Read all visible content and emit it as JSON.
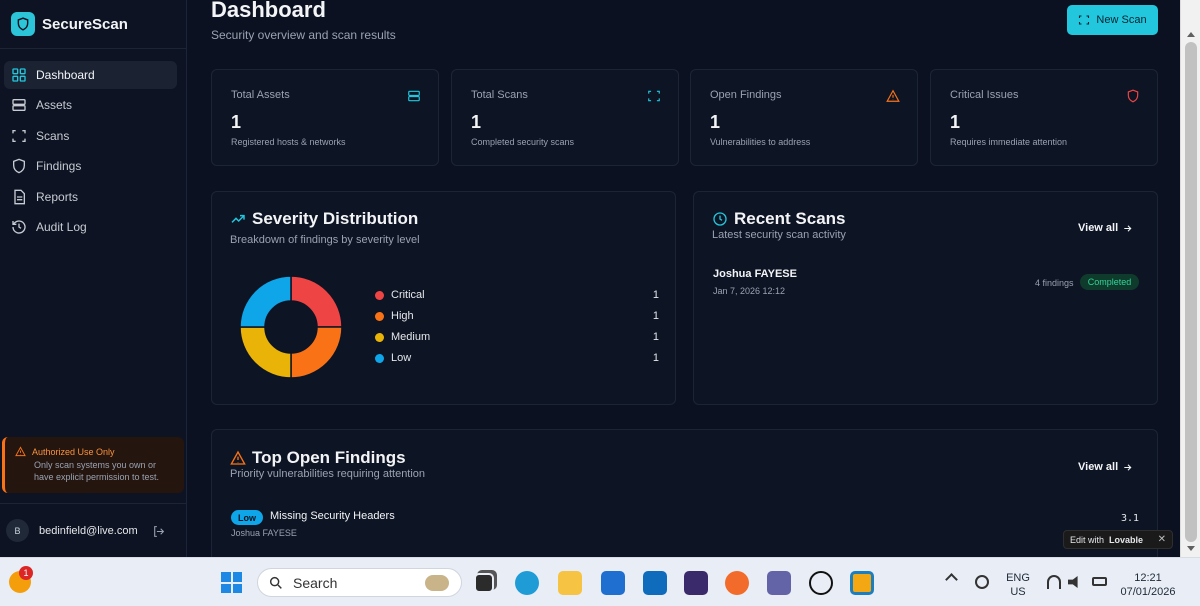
{
  "app": {
    "name": "SecureScan"
  },
  "sidebar": {
    "items": [
      {
        "label": "Dashboard",
        "icon": "dashboard-icon",
        "active": true
      },
      {
        "label": "Assets",
        "icon": "server-icon"
      },
      {
        "label": "Scans",
        "icon": "scan-icon"
      },
      {
        "label": "Findings",
        "icon": "shield-icon"
      },
      {
        "label": "Reports",
        "icon": "report-icon"
      },
      {
        "label": "Audit Log",
        "icon": "history-icon"
      }
    ],
    "warning": {
      "title": "Authorized Use Only",
      "text": "Only scan systems you own or have explicit permission to test."
    },
    "user": {
      "initial": "B",
      "email": "bedinfield@live.com"
    }
  },
  "header": {
    "title": "Dashboard",
    "subtitle": "Security overview and scan results",
    "new_scan_label": "New Scan"
  },
  "stats": [
    {
      "label": "Total Assets",
      "value": "1",
      "desc": "Registered hosts & networks",
      "icon": "server-icon",
      "color": "#22c7dd"
    },
    {
      "label": "Total Scans",
      "value": "1",
      "desc": "Completed security scans",
      "icon": "scan-icon",
      "color": "#22c7dd"
    },
    {
      "label": "Open Findings",
      "value": "1",
      "desc": "Vulnerabilities to address",
      "icon": "warning-icon",
      "color": "#f97316"
    },
    {
      "label": "Critical Issues",
      "value": "1",
      "desc": "Requires immediate attention",
      "icon": "shield-icon",
      "color": "#ef4444"
    }
  ],
  "severity": {
    "title": "Severity Distribution",
    "subtitle": "Breakdown of findings by severity level"
  },
  "chart_data": {
    "type": "pie",
    "categories": [
      "Critical",
      "High",
      "Medium",
      "Low"
    ],
    "values": [
      1,
      1,
      1,
      1
    ],
    "colors": [
      "#ef4444",
      "#f97316",
      "#eab308",
      "#0ea5e9"
    ],
    "donut": true,
    "legend": "right"
  },
  "recent_scans": {
    "title": "Recent Scans",
    "subtitle": "Latest security scan activity",
    "view_all": "View all",
    "items": [
      {
        "name": "Joshua FAYESE",
        "date": "Jan 7, 2026 12:12",
        "findings": "4 findings",
        "status": "Completed"
      }
    ]
  },
  "top_findings": {
    "title": "Top Open Findings",
    "subtitle": "Priority vulnerabilities requiring attention",
    "view_all": "View all",
    "items": [
      {
        "severity": "Low",
        "title": "Missing Security Headers",
        "target": "Joshua FAYESE",
        "score": "3.1"
      }
    ]
  },
  "lovable": {
    "prefix": "Edit with",
    "brand": "Lovable",
    "close": "✕"
  },
  "taskbar": {
    "notification_count": "1",
    "search_placeholder": "Search",
    "lang": "ENG",
    "region": "US",
    "time": "12:21",
    "date": "07/01/2026"
  }
}
